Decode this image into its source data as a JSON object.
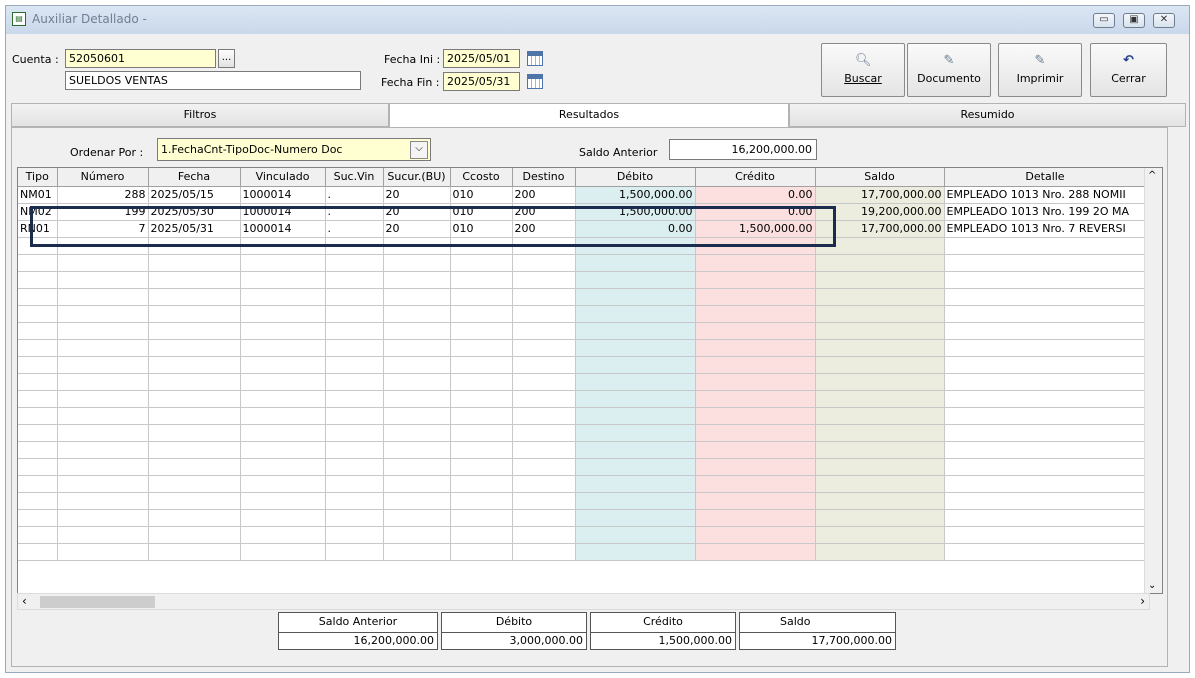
{
  "window": {
    "title": "Auxiliar Detallado -",
    "app_icon": "spreadsheet-icon",
    "controls": [
      "minimize-icon",
      "maximize-icon",
      "close-icon"
    ]
  },
  "header": {
    "cuenta_label": "Cuenta :",
    "cuenta_value": "52050601",
    "lookup_button": "...",
    "cuenta_name": "SUELDOS VENTAS",
    "fecha_ini_label": "Fecha Ini :",
    "fecha_ini_value": "2025/05/01",
    "fecha_fin_label": "Fecha Fin :",
    "fecha_fin_value": "2025/05/31"
  },
  "toolbar": {
    "buscar": "Buscar",
    "documento": "Documento",
    "imprimir": "Imprimir",
    "cerrar": "Cerrar"
  },
  "tabs": [
    "Filtros",
    "Resultados",
    "Resumido"
  ],
  "active_tab": "Resultados",
  "resultados": {
    "ordenar_label": "Ordenar Por :",
    "ordenar_value": "1.FechaCnt-TipoDoc-Numero Doc",
    "saldo_anterior_label": "Saldo Anterior",
    "saldo_anterior_value": "16,200,000.00"
  },
  "grid": {
    "columns": [
      "Tipo",
      "Número",
      "Fecha",
      "Vinculado",
      "Suc.Vin",
      "Sucur.(BU)",
      "Ccosto",
      "Destino",
      "Débito",
      "Crédito",
      "Saldo",
      "Detalle"
    ],
    "rows": [
      [
        "NM01",
        "288",
        "2025/05/15",
        "1000014",
        ".",
        "20",
        "010",
        "200",
        "1,500,000.00",
        "0.00",
        "17,700,000.00",
        "EMPLEADO 1013 Nro. 288 NOMII"
      ],
      [
        "NM02",
        "199",
        "2025/05/30",
        "1000014",
        ".",
        "20",
        "010",
        "200",
        "1,500,000.00",
        "0.00",
        "19,200,000.00",
        "EMPLEADO 1013 Nro. 199 2O MA"
      ],
      [
        "RN01",
        "7",
        "2025/05/31",
        "1000014",
        ".",
        "20",
        "010",
        "200",
        "0.00",
        "1,500,000.00",
        "17,700,000.00",
        "EMPLEADO 1013 Nro. 7 REVERSI"
      ]
    ]
  },
  "totals": {
    "saldo_anterior_label": "Saldo Anterior",
    "saldo_anterior": "16,200,000.00",
    "debito_label": "Débito",
    "debito": "3,000,000.00",
    "credito_label": "Crédito",
    "credito": "1,500,000.00",
    "saldo_label": "Saldo",
    "saldo": "17,700,000.00"
  },
  "colors": {
    "debito_column": "#dceff0",
    "credito_column": "#fce0e0",
    "saldo_column": "#ededdf",
    "input_highlight": "#ffffd2",
    "highlight_box": "#1c2c4f"
  }
}
